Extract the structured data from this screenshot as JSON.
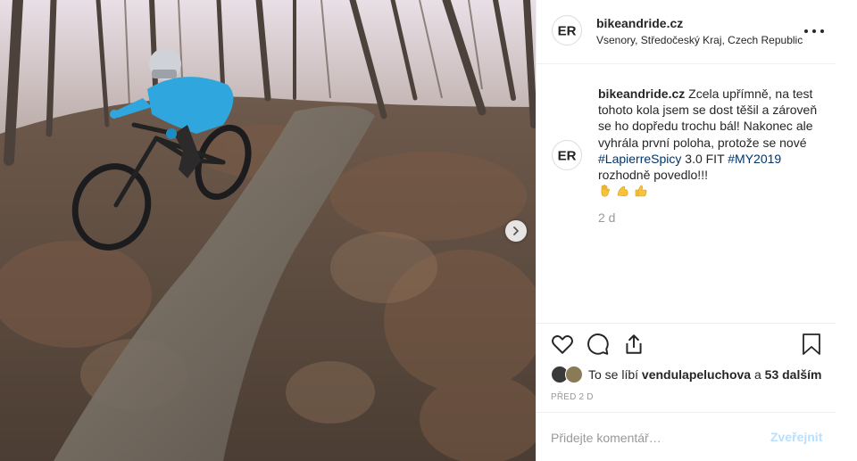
{
  "post": {
    "photo_alt": "",
    "next_icon": "chevron-right-icon"
  },
  "header": {
    "username": "bikeandride.cz",
    "location": "Vsenory, Středočeský Kraj, Czech Republic",
    "avatar_logo": "ER",
    "more_icon": "more-options-icon"
  },
  "caption": {
    "author": "bikeandride.cz",
    "text_1": "Zcela upřímně, na test tohoto kola jsem se dost těšil a zároveň se ho dopředu trochu bál! Nakonec ale vyhrála první poloha, protože se nové ",
    "hashtag_1": "#LapierreSpicy",
    "text_2": " 3.0 FIT ",
    "hashtag_2": "#MY2019",
    "text_3": " rozhodně povedlo!!!",
    "emojis": [
      "raised-hand-emoji",
      "flexed-biceps-emoji",
      "thumbs-up-emoji"
    ],
    "time_ago": "2 d"
  },
  "actions": {
    "like_icon": "heart-icon",
    "comment_icon": "comment-icon",
    "share_icon": "share-icon",
    "save_icon": "bookmark-icon"
  },
  "likes": {
    "prefix": "To se líbí ",
    "user": "vendulapeluchova",
    "middle": " a ",
    "count": "53 dalším"
  },
  "post_date": "PŘED 2 D",
  "comment_box": {
    "placeholder": "Přidejte komentář…",
    "post_label": "Zveřejnit"
  },
  "colors": {
    "text": "#262626",
    "muted": "#999999",
    "hashtag": "#003569",
    "post_disabled": "#b9dffc",
    "border": "#efefef"
  }
}
